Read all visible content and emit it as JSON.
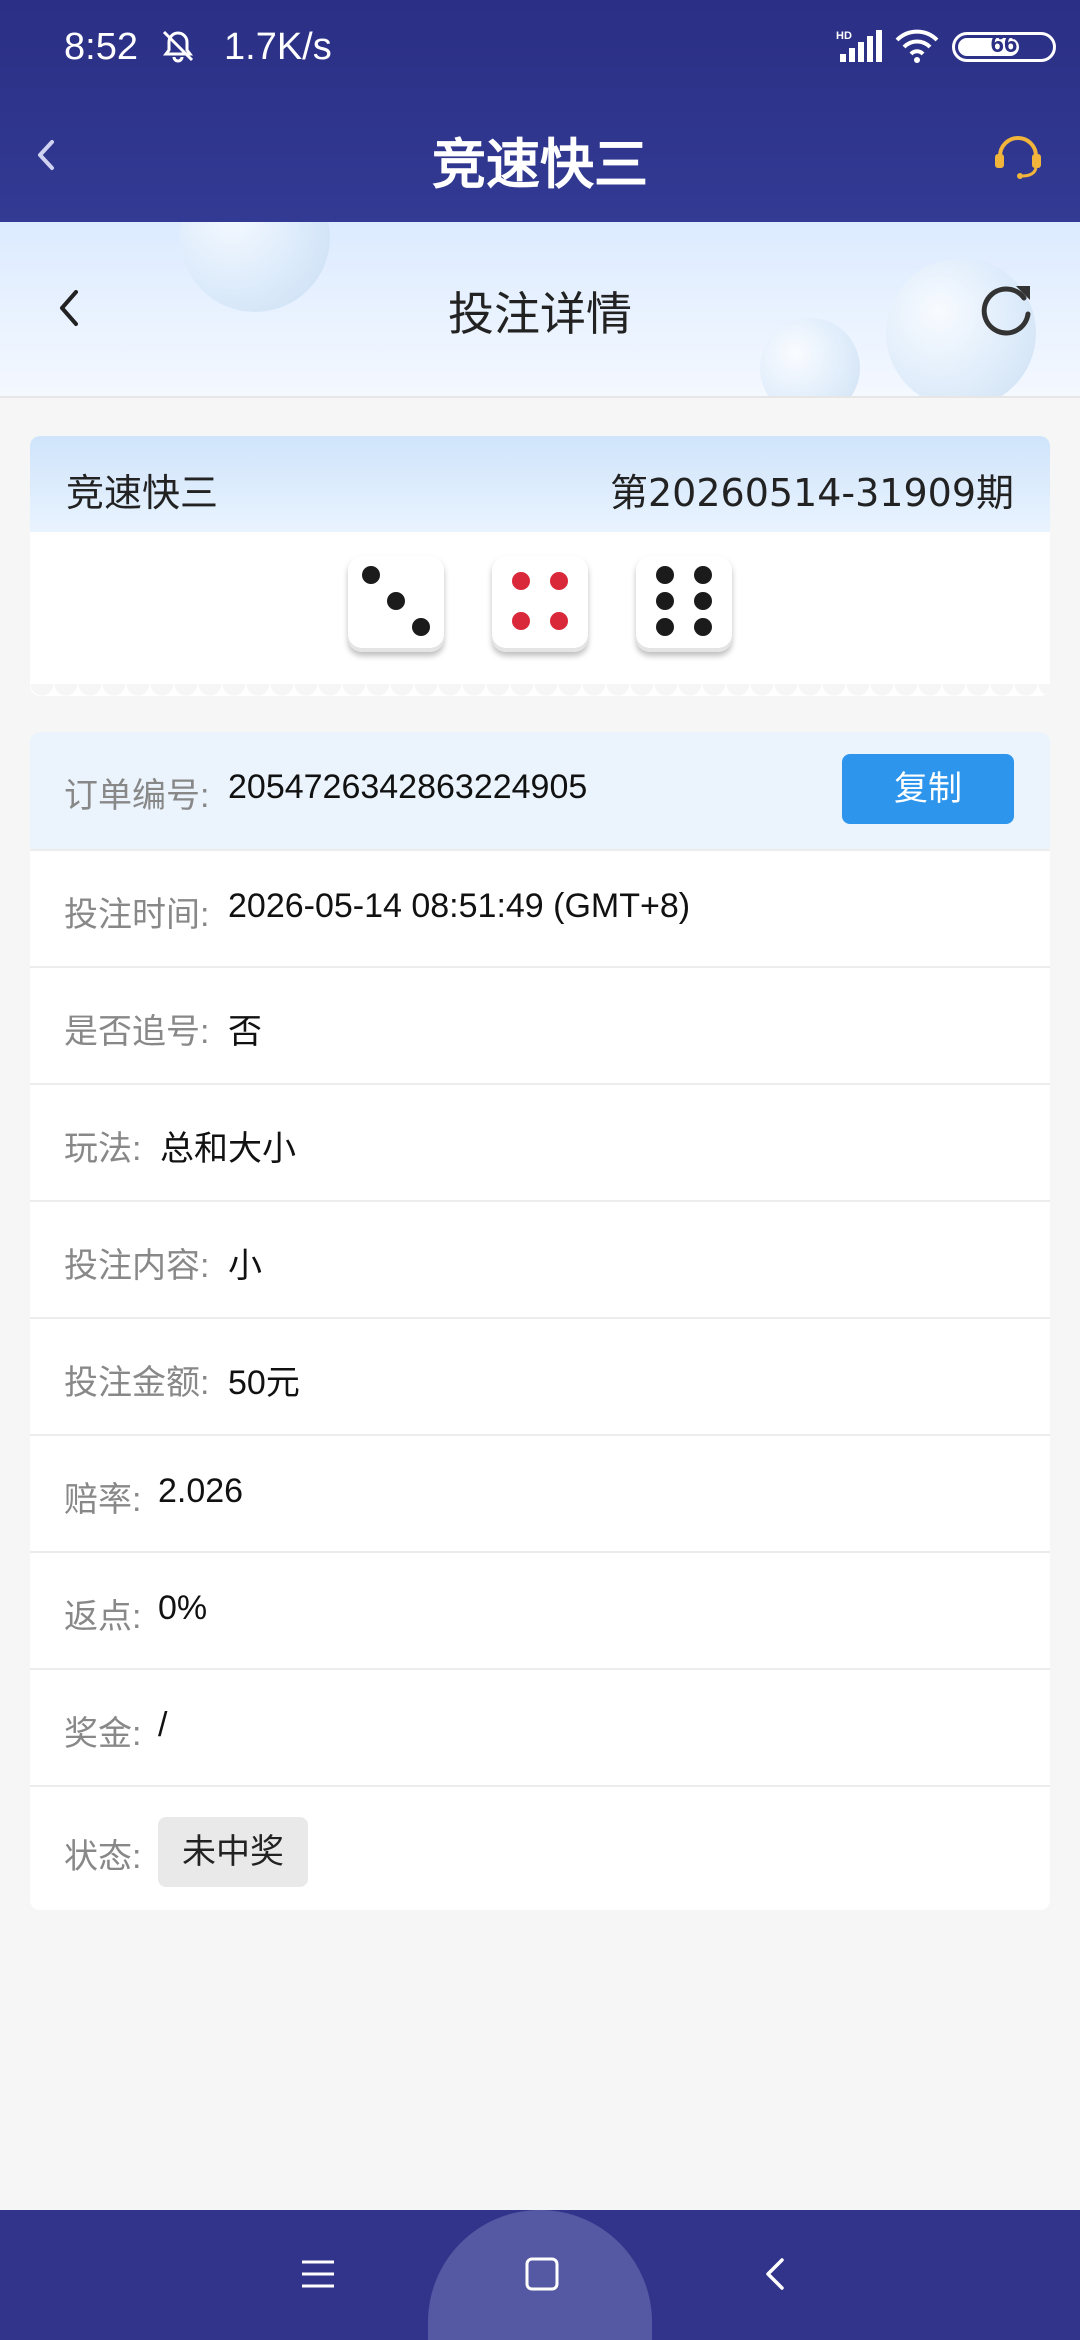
{
  "status_bar": {
    "time": "8:52",
    "net_speed": "1.7K/s",
    "network_label": "HD",
    "battery": "66"
  },
  "header": {
    "title": "竞速快三"
  },
  "subheader": {
    "title": "投注详情"
  },
  "draw": {
    "lottery_name": "竞速快三",
    "issue": "第20260514-31909期",
    "dice": [
      3,
      4,
      6
    ]
  },
  "order": {
    "order_no_label": "订单编号:",
    "order_no": "2054726342863224905",
    "copy_label": "复制",
    "bet_time_label": "投注时间:",
    "bet_time": "2026-05-14 08:51:49 (GMT+8)",
    "chase_label": "是否追号:",
    "chase": "否",
    "play_label": "玩法:",
    "play": "总和大小",
    "content_label": "投注内容:",
    "content": "小",
    "amount_label": "投注金额:",
    "amount": "50元",
    "odds_label": "赔率:",
    "odds": "2.026",
    "rebate_label": "返点:",
    "rebate": "0%",
    "prize_label": "奖金:",
    "prize": "/",
    "status_label": "状态:",
    "status": "未中奖"
  },
  "colors": {
    "header_bg": "#2b2f85",
    "copy_button": "#2e95ec",
    "dice_red": "#d9283a",
    "support_icon": "#f0b53a"
  },
  "icons": {
    "back": "chevron-left-icon",
    "support": "headset-icon",
    "refresh": "refresh-icon",
    "nav_menu": "menu-icon",
    "nav_home": "square-icon",
    "nav_back": "chevron-left-icon"
  }
}
